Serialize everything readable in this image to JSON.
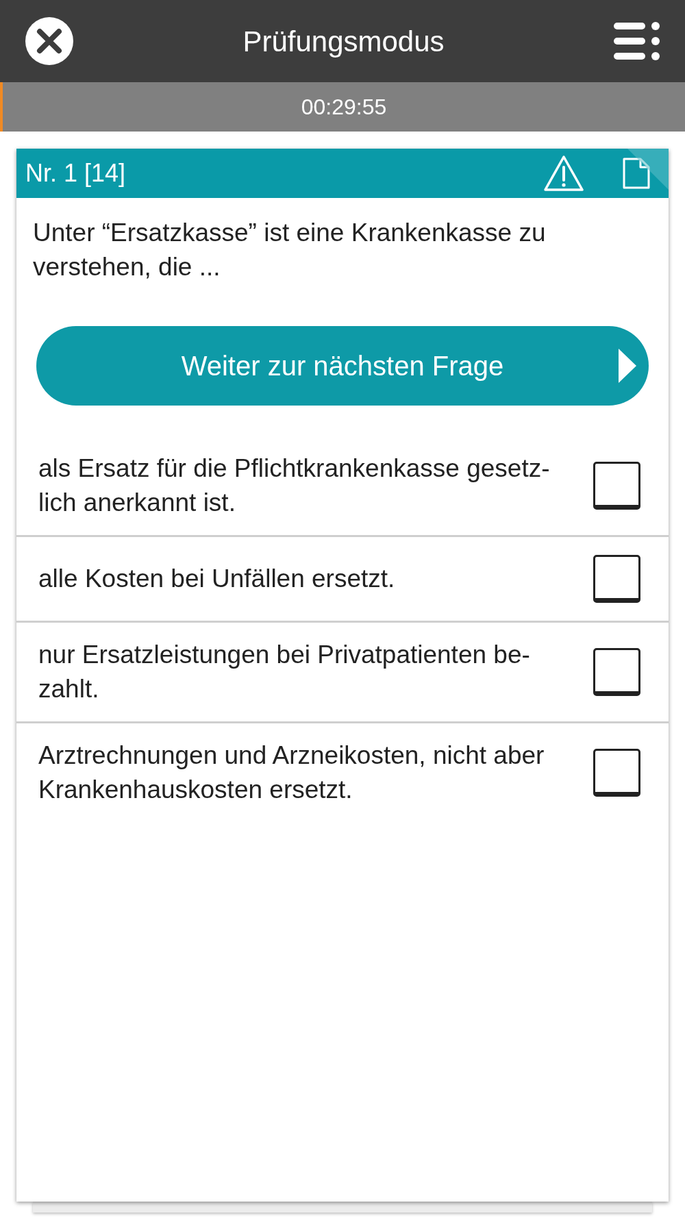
{
  "header": {
    "title": "Prüfungsmodus"
  },
  "timer": {
    "time": "00:29:55"
  },
  "question": {
    "number": "Nr. 1 [14]",
    "lines": [
      "Unter “Ersatzkasse” ist eine Krankenkasse zu",
      "verstehen, die ..."
    ]
  },
  "next_button": {
    "label": "Weiter zur nächsten Frage"
  },
  "answers": [
    {
      "lines": [
        "als Ersatz für die Pflichtkrankenkasse gesetz-",
        "lich anerkannt ist."
      ],
      "checked": false
    },
    {
      "lines": [
        "alle Kosten bei Unfällen ersetzt."
      ],
      "checked": false
    },
    {
      "lines": [
        "nur Ersatzleistungen bei Privatpatienten be-",
        "zahlt."
      ],
      "checked": false
    },
    {
      "lines": [
        "Arztrechnungen und Arzneikosten, nicht aber",
        "Krankenhauskosten ersetzt."
      ],
      "checked": false
    }
  ]
}
